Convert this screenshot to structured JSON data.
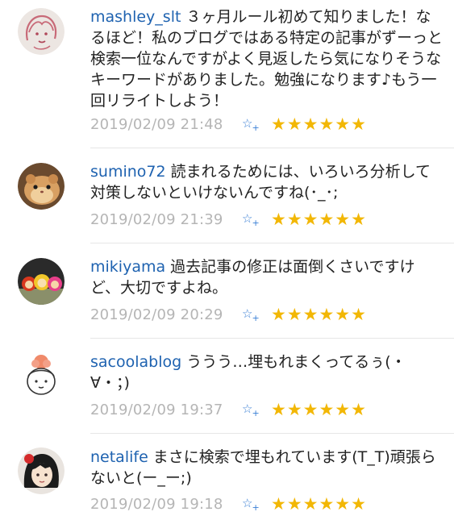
{
  "colors": {
    "username": "#1e62b0",
    "timestamp": "#b5b5b5",
    "star": "#f2b705",
    "add_star": "#3a7fd5"
  },
  "comments": [
    {
      "username": "mashley_slt",
      "text": "３ヶ月ルール初めて知りました！なるほど！私のブログではある特定の記事がずーっと検索一位なんですがよく見返したら気になりそうなキーワードがありました。勉強になります♪もう一回リライトしよう！",
      "timestamp": "2019/02/09 21:48",
      "add_star": "☆",
      "add_star_plus": "+",
      "stars": "★★★★★★",
      "star_count": 6,
      "avatar_icon": "sketch-face-avatar"
    },
    {
      "username": "sumino72",
      "text": "読まれるためには、いろいろ分析して対策しないといけないんですね(･_･;",
      "timestamp": "2019/02/09 21:39",
      "add_star": "☆",
      "add_star_plus": "+",
      "stars": "★★★★★★",
      "star_count": 6,
      "avatar_icon": "hamster-avatar"
    },
    {
      "username": "mikiyama",
      "text": "過去記事の修正は面倒くさいですけど、大切ですよね。",
      "timestamp": "2019/02/09 20:29",
      "add_star": "☆",
      "add_star_plus": "+",
      "stars": "★★★★★★",
      "star_count": 6,
      "avatar_icon": "figurines-avatar"
    },
    {
      "username": "sacoolablog",
      "text": "ううう…埋もれまくってるぅ(・∀・；)",
      "timestamp": "2019/02/09 19:37",
      "add_star": "☆",
      "add_star_plus": "+",
      "stars": "★★★★★★",
      "star_count": 6,
      "avatar_icon": "cartoon-girl-avatar"
    },
    {
      "username": "netalife",
      "text": "まさに検索で埋もれています(T_T)頑張らないと(ー_ー;)",
      "timestamp": "2019/02/09 19:18",
      "add_star": "☆",
      "add_star_plus": "+",
      "stars": "★★★★★★",
      "star_count": 6,
      "avatar_icon": "anime-girl-avatar"
    }
  ]
}
